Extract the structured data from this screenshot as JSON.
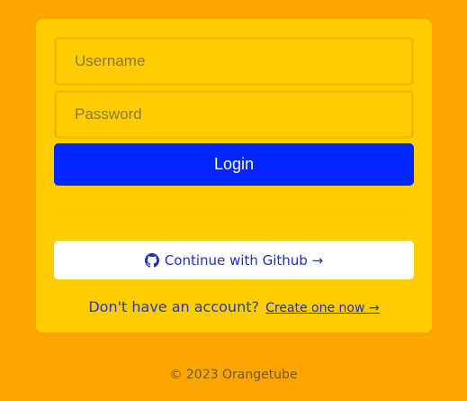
{
  "form": {
    "username_placeholder": "Username",
    "password_placeholder": "Password",
    "login_label": "Login"
  },
  "social": {
    "github_icon": "github-icon",
    "github_label": "Continue with Github →"
  },
  "signup": {
    "prompt": "Don't have an account?",
    "link_label": "Create one now →"
  },
  "footer": {
    "text": "© 2023 Orangetube"
  },
  "colors": {
    "page_bg": "#FFA500",
    "card_bg": "#FFCC00",
    "primary_button": "#0026FF",
    "link_color": "#1F2FBF"
  }
}
